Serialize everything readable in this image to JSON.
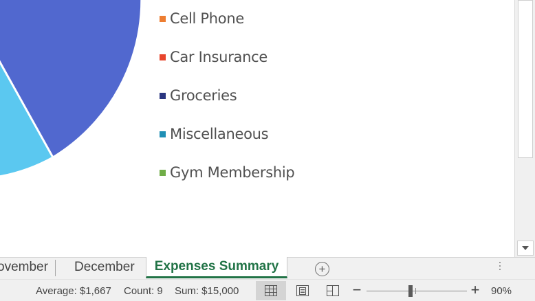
{
  "chart": {
    "legend": [
      {
        "label": "Cell Phone",
        "color": "#ed7d31"
      },
      {
        "label": "Car Insurance",
        "color": "#e8452c"
      },
      {
        "label": "Groceries",
        "color": "#2a3580"
      },
      {
        "label": "Miscellaneous",
        "color": "#1f8fb5"
      },
      {
        "label": "Gym Membership",
        "color": "#70ad47"
      }
    ],
    "visible_slices": [
      {
        "color": "#5168cf"
      },
      {
        "color": "#5bc8f0"
      }
    ]
  },
  "sheet_tabs": {
    "tabs": [
      "ovember",
      "December",
      "Expenses Summary"
    ],
    "active": "Expenses Summary",
    "add_icon": "plus-circle-icon"
  },
  "status_bar": {
    "average": "Average: $1,667",
    "count": "Count: 9",
    "sum": "Sum: $15,000",
    "zoom": "90%",
    "zoom_minus": "−",
    "zoom_plus": "+",
    "view_icons": [
      "normal-view-icon",
      "page-layout-icon",
      "page-break-preview-icon"
    ]
  },
  "colors": {
    "accent": "#217346"
  }
}
